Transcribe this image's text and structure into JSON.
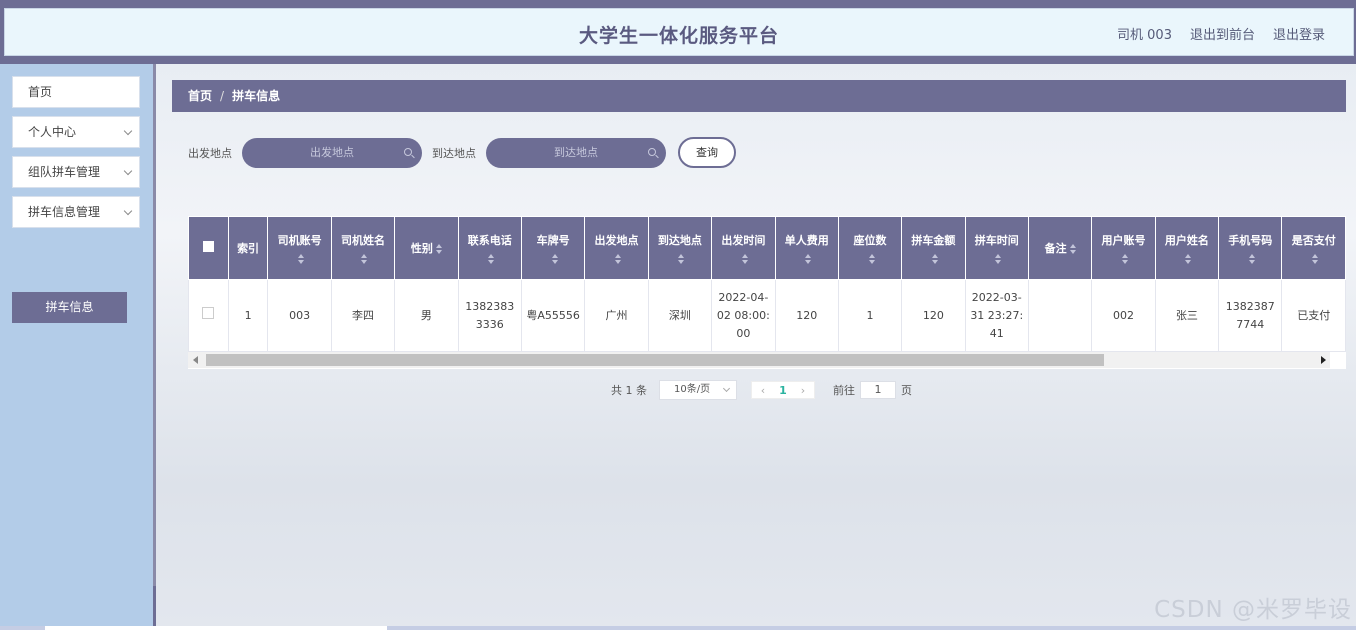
{
  "header": {
    "title": "大学生一体化服务平台",
    "user": "司机 003",
    "back_front": "退出到前台",
    "logout": "退出登录"
  },
  "sidebar": {
    "items": [
      {
        "label": "首页"
      },
      {
        "label": "个人中心"
      },
      {
        "label": "组队拼车管理"
      },
      {
        "label": "拼车信息管理"
      }
    ],
    "active_sub": "拼车信息"
  },
  "breadcrumb": {
    "home": "首页",
    "sep": "/",
    "current": "拼车信息"
  },
  "search": {
    "from_label": "出发地点",
    "from_placeholder": "出发地点",
    "to_label": "到达地点",
    "to_placeholder": "到达地点",
    "query_button": "查询"
  },
  "table": {
    "columns": [
      "索引",
      "司机账号",
      "司机姓名",
      "性别",
      "联系电话",
      "车牌号",
      "出发地点",
      "到达地点",
      "出发时间",
      "单人费用",
      "座位数",
      "拼车金额",
      "拼车时间",
      "备注",
      "用户账号",
      "用户姓名",
      "手机号码",
      "是否支付"
    ],
    "row": [
      "1",
      "003",
      "李四",
      "男",
      "13823833336",
      "粤A55556",
      "广州",
      "深圳",
      "2022-04-02 08:00:00",
      "120",
      "1",
      "120",
      "2022-03-31 23:27:41",
      "",
      "002",
      "张三",
      "13823877744",
      "已支付"
    ]
  },
  "pagination": {
    "total": "共 1 条",
    "page_size": "10条/页",
    "prev": "‹",
    "current_page": "1",
    "next": "›",
    "goto_label": "前往",
    "goto_value": "1",
    "page_unit": "页"
  },
  "watermark": "CSDN @米罗毕设"
}
